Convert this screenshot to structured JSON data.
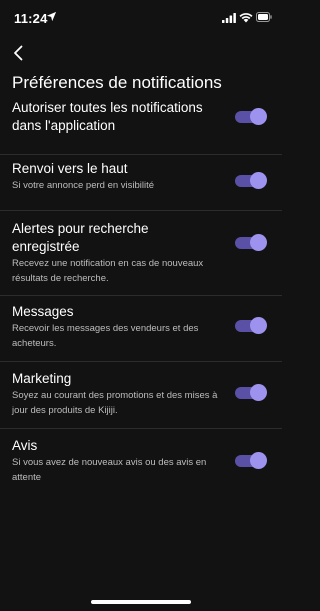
{
  "status_bar": {
    "time": "11:24",
    "icons": [
      "location-arrow-icon",
      "signal-icon",
      "wifi-icon",
      "battery-icon"
    ]
  },
  "header": {
    "back_icon": "chevron-left-icon",
    "title": "Préférences de notifications"
  },
  "settings": [
    {
      "label": "Autoriser toutes les notifications dans l'application",
      "description": "",
      "enabled": true
    },
    {
      "label": "Renvoi vers le haut",
      "description": "Si votre annonce perd en visibilité",
      "enabled": true
    },
    {
      "label": "Alertes pour recherche enregistrée",
      "description": "Recevez une notification en cas de nouveaux résultats de recherche.",
      "enabled": true
    },
    {
      "label": "Messages",
      "description": "Recevoir les messages des vendeurs et des acheteurs.",
      "enabled": true
    },
    {
      "label": "Marketing",
      "description": "Soyez au courant des promotions et des mises à jour des produits de Kijiji.",
      "enabled": true
    },
    {
      "label": "Avis",
      "description": "Si vous avez de nouveaux avis ou des avis en attente",
      "enabled": true
    }
  ],
  "colors": {
    "background": "#121212",
    "toggle_track_on": "#5a50a6",
    "toggle_knob_on": "#9d93ef",
    "divider": "#2c2c2c",
    "secondary_text": "#bdbdbd"
  }
}
